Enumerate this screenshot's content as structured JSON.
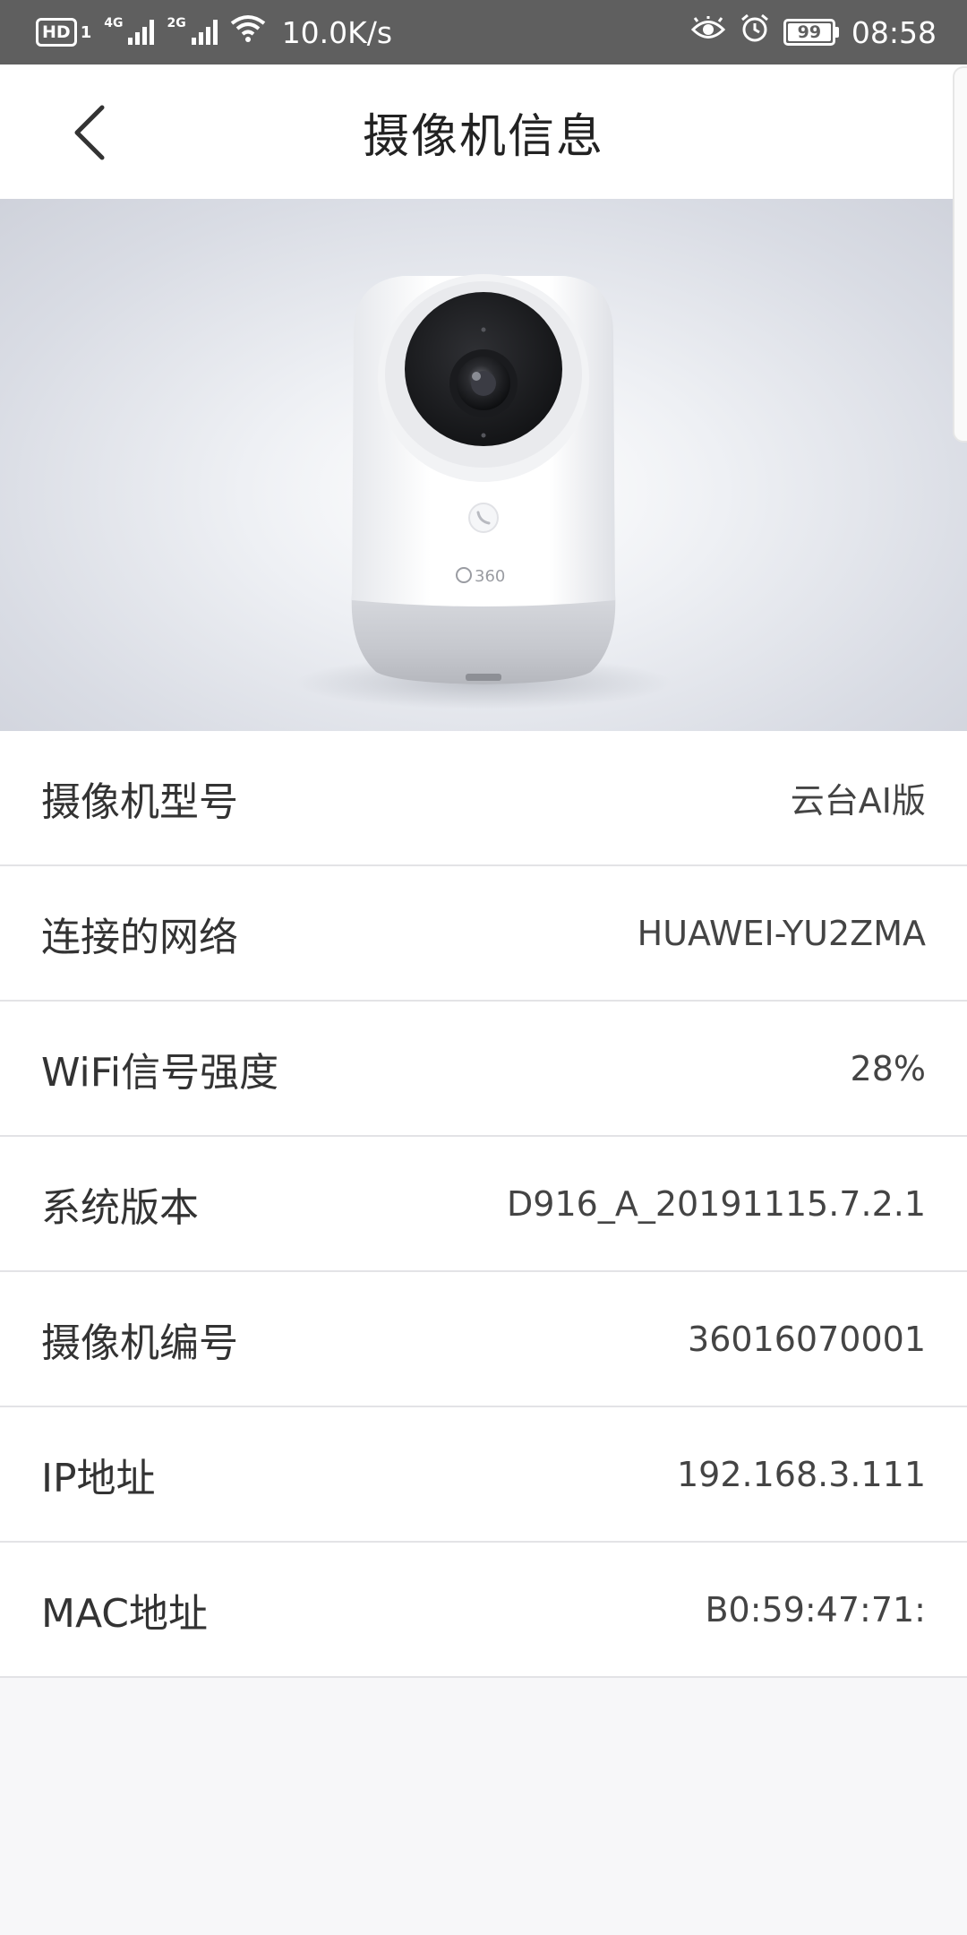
{
  "status_bar": {
    "hd": "HD",
    "sim1": "1",
    "net1": "4G",
    "net2": "2G",
    "speed": "10.0K/s",
    "battery": "99",
    "time": "08:58",
    "icons": [
      "eye-icon",
      "alarm-icon",
      "wifi-icon",
      "battery-icon"
    ]
  },
  "header": {
    "title": "摄像机信息",
    "back_icon": "chevron-left-icon"
  },
  "hero": {
    "brand": "360"
  },
  "info": {
    "rows": [
      {
        "label": "摄像机型号",
        "value": "云台AI版"
      },
      {
        "label": "连接的网络",
        "value": "HUAWEI-YU2ZMA"
      },
      {
        "label": "WiFi信号强度",
        "value": "28%"
      },
      {
        "label": "系统版本",
        "value": "D916_A_20191115.7.2.1"
      },
      {
        "label": "摄像机编号",
        "value": "36016070001"
      },
      {
        "label": "IP地址",
        "value": "192.168.3.111"
      },
      {
        "label": "MAC地址",
        "value": "B0:59:47:71:"
      }
    ]
  },
  "colors": {
    "status_bar_bg": "#5f5f5f",
    "page_bg": "#f7f7f9",
    "divider": "#e3e3e6"
  }
}
